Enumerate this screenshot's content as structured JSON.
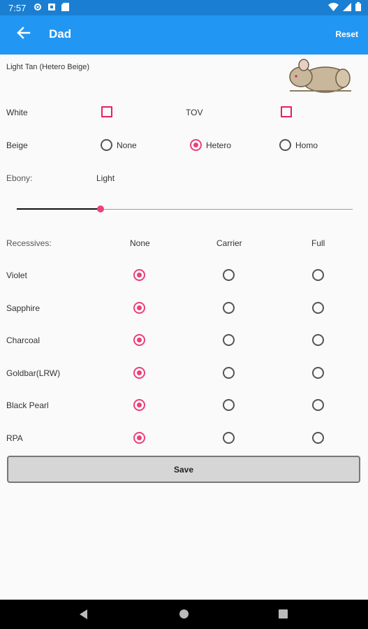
{
  "status_bar": {
    "time": "7:57"
  },
  "app_bar": {
    "title": "Dad",
    "reset_label": "Reset"
  },
  "color_summary": {
    "name": "Light Tan (Hetero Beige)"
  },
  "traits": {
    "white_label": "White",
    "white_checked": false,
    "tov_label": "TOV",
    "tov_checked": false,
    "beige_label": "Beige",
    "beige_options": [
      "None",
      "Hetero",
      "Homo"
    ],
    "beige_selected": "Hetero"
  },
  "ebony": {
    "label": "Ebony:",
    "value_label": "Light",
    "level": 0.25
  },
  "recessives": {
    "header_label": "Recessives:",
    "columns": [
      "None",
      "Carrier",
      "Full"
    ],
    "rows": [
      {
        "label": "Violet",
        "selected": "None"
      },
      {
        "label": "Sapphire",
        "selected": "None"
      },
      {
        "label": "Charcoal",
        "selected": "None"
      },
      {
        "label": "Goldbar(LRW)",
        "selected": "None"
      },
      {
        "label": "Black Pearl",
        "selected": "None"
      },
      {
        "label": "RPA",
        "selected": "None"
      }
    ]
  },
  "save_label": "Save",
  "colors": {
    "primary": "#2196f3",
    "accent": "#ec407a",
    "status_bar": "#1a7fd3"
  }
}
